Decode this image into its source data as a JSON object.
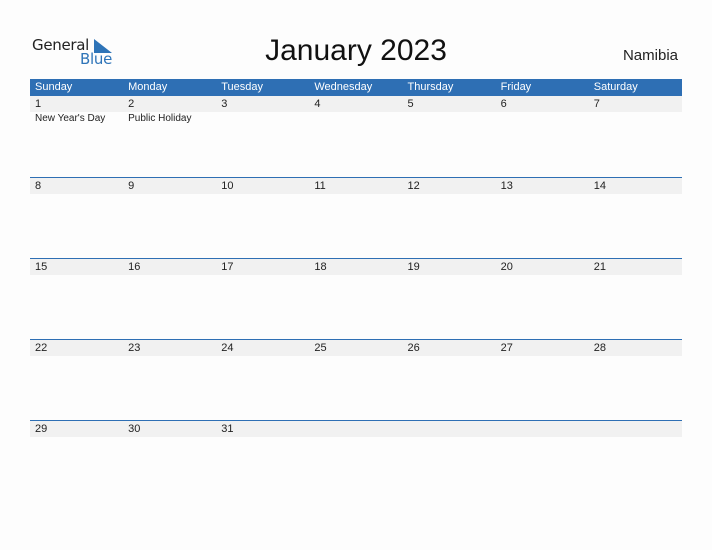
{
  "logo": {
    "general": "General",
    "blue": "Blue"
  },
  "title": "January 2023",
  "country": "Namibia",
  "colors": {
    "header": "#2e6fb4",
    "brand_blue": "#2e74b8",
    "date_strip": "#f1f1f1"
  },
  "weekdays": [
    "Sunday",
    "Monday",
    "Tuesday",
    "Wednesday",
    "Thursday",
    "Friday",
    "Saturday"
  ],
  "weeks": [
    {
      "days": [
        "1",
        "2",
        "3",
        "4",
        "5",
        "6",
        "7"
      ],
      "events": [
        "New Year's Day",
        "Public Holiday",
        "",
        "",
        "",
        "",
        ""
      ]
    },
    {
      "days": [
        "8",
        "9",
        "10",
        "11",
        "12",
        "13",
        "14"
      ],
      "events": [
        "",
        "",
        "",
        "",
        "",
        "",
        ""
      ]
    },
    {
      "days": [
        "15",
        "16",
        "17",
        "18",
        "19",
        "20",
        "21"
      ],
      "events": [
        "",
        "",
        "",
        "",
        "",
        "",
        ""
      ]
    },
    {
      "days": [
        "22",
        "23",
        "24",
        "25",
        "26",
        "27",
        "28"
      ],
      "events": [
        "",
        "",
        "",
        "",
        "",
        "",
        ""
      ]
    },
    {
      "days": [
        "29",
        "30",
        "31",
        "",
        "",
        "",
        ""
      ],
      "events": [
        "",
        "",
        "",
        "",
        "",
        "",
        ""
      ]
    }
  ]
}
